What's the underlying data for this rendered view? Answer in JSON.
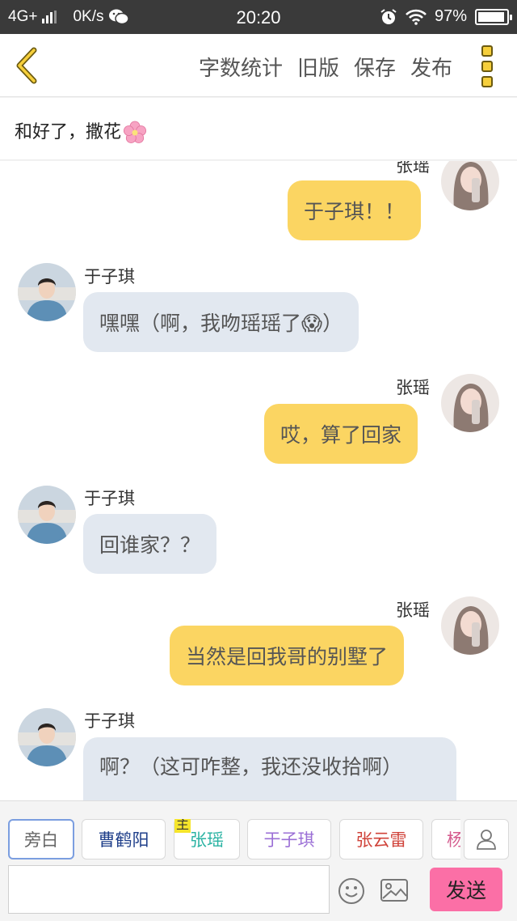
{
  "status_bar": {
    "network": "4G+",
    "speed": "0K/s",
    "time": "20:20",
    "battery": "97%",
    "icons": [
      "signal-icon",
      "wechat-icon",
      "alarm-icon",
      "wifi-icon",
      "battery-icon"
    ]
  },
  "toolbar": {
    "word_count": "字数统计",
    "old_version": "旧版",
    "save": "保存",
    "publish": "发布"
  },
  "story": {
    "title": "和好了，撒花"
  },
  "messages": [
    {
      "side": "right",
      "name": "张瑶",
      "text": "于子琪！！"
    },
    {
      "side": "left",
      "name": "于子琪",
      "text": "嘿嘿（啊，我吻瑶瑶了😱）"
    },
    {
      "side": "right",
      "name": "张瑶",
      "text": "哎，算了回家"
    },
    {
      "side": "left",
      "name": "于子琪",
      "text": "回谁家？？"
    },
    {
      "side": "right",
      "name": "张瑶",
      "text": "当然是回我哥的别墅了"
    },
    {
      "side": "left",
      "name": "于子琪",
      "text": "啊？（这可咋整，我还没收拾啊）"
    }
  ],
  "roles": [
    {
      "label": "旁白",
      "color": "#666666"
    },
    {
      "label": "曹鹤阳",
      "color": "#1f3f8a"
    },
    {
      "label": "张瑶",
      "color": "#2bb3a3",
      "tag": "主"
    },
    {
      "label": "于子琪",
      "color": "#9b6fd6"
    },
    {
      "label": "张云雷",
      "color": "#d0433a"
    },
    {
      "label": "杨",
      "color": "#d45a8d"
    }
  ],
  "composer": {
    "input_value": "",
    "send_label": "发送"
  }
}
